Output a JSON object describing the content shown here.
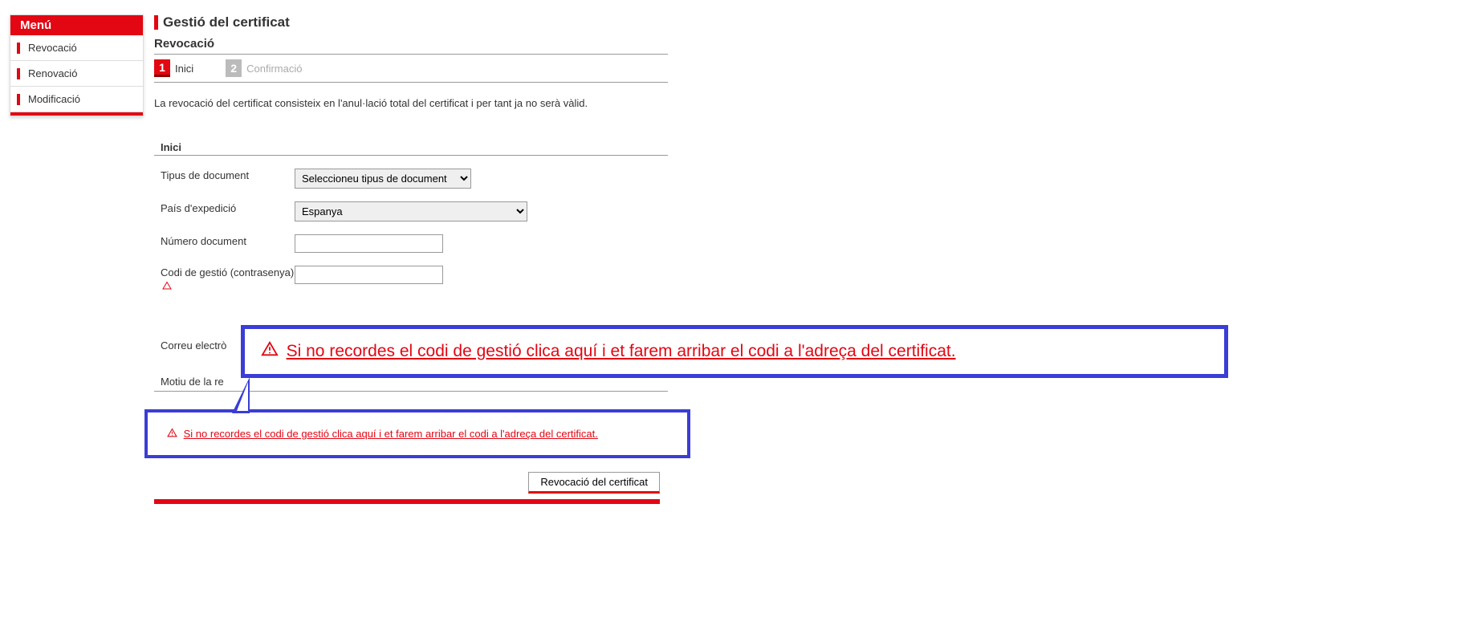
{
  "menu": {
    "header": "Menú",
    "items": [
      {
        "label": "Revocació"
      },
      {
        "label": "Renovació"
      },
      {
        "label": "Modificació"
      }
    ]
  },
  "page_title": "Gestió del certificat",
  "sub_title": "Revocació",
  "steps": [
    {
      "num": "1",
      "label": "Inici"
    },
    {
      "num": "2",
      "label": "Confirmació"
    }
  ],
  "description": "La revocació del certificat consisteix en l'anul·lació total del certificat i per tant ja no serà vàlid.",
  "section_label": "Inici",
  "form": {
    "doc_type_label": "Tipus de document",
    "doc_type_value": "Seleccioneu tipus de document",
    "country_label": "País d'expedició",
    "country_value": "Espanya",
    "doc_num_label": "Número document",
    "doc_num_value": "",
    "code_label": "Codi de gestió (contrasenya)",
    "code_value": "",
    "email_label_partial": "Correu electrò",
    "motiu_label_partial": "Motiu de la re"
  },
  "callout_text": "Si no recordes el codi de gestió clica aquí i et farem arribar el codi a l'adreça del certificat.",
  "submit_label": "Revocació del certificat"
}
